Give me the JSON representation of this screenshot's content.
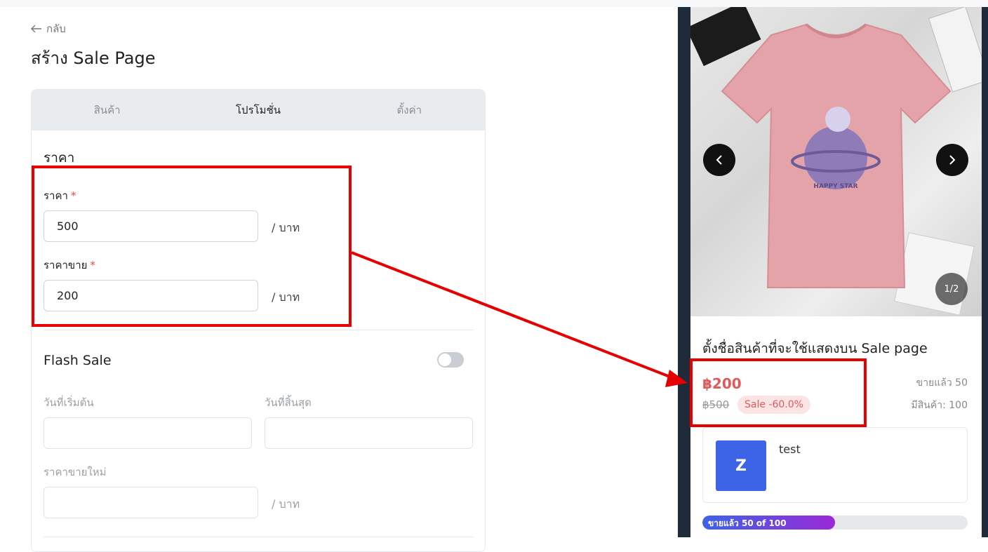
{
  "colors": {
    "accent_red": "#e60000",
    "price_red": "#e05a5a",
    "brand_blue": "#3d63e6",
    "progress_end": "#9b29d6"
  },
  "header": {
    "back_label": "กลับ",
    "back_icon": "arrow-left-icon",
    "title": "สร้าง Sale Page"
  },
  "tabs": [
    {
      "label": "สินค้า",
      "active": false
    },
    {
      "label": "โปรโมชั่น",
      "active": true
    },
    {
      "label": "ตั้งค่า",
      "active": false
    }
  ],
  "pricing": {
    "section_title": "ราคา",
    "price_label": "ราคา",
    "price_value": "500",
    "sale_price_label": "ราคาขาย",
    "sale_price_value": "200",
    "unit": "/ บาท",
    "required_mark": "*"
  },
  "flash_sale": {
    "title": "Flash Sale",
    "enabled": false,
    "start_label": "วันที่เริ่มต้น",
    "start_value": "",
    "end_label": "วันที่สิ้นสุด",
    "end_value": "",
    "new_price_label": "ราคาขายใหม่",
    "new_price_value": "",
    "unit": "/ บาท"
  },
  "preview": {
    "image_text": "HAPPY STAR",
    "image_counter": "1/2",
    "product_name": "ตั้งชื่อสินค้าที่จะใช้แสดงบน Sale page",
    "price": "฿200",
    "old_price": "฿500",
    "sale_badge": "Sale -60.0%",
    "sold": "ขายแล้ว 50",
    "stock": "มีสินค้า: 100",
    "shop": {
      "avatar_letter": "Z",
      "name": "test"
    },
    "progress": {
      "label": "ขายแล้ว 50 of 100",
      "fraction": 0.5
    }
  }
}
